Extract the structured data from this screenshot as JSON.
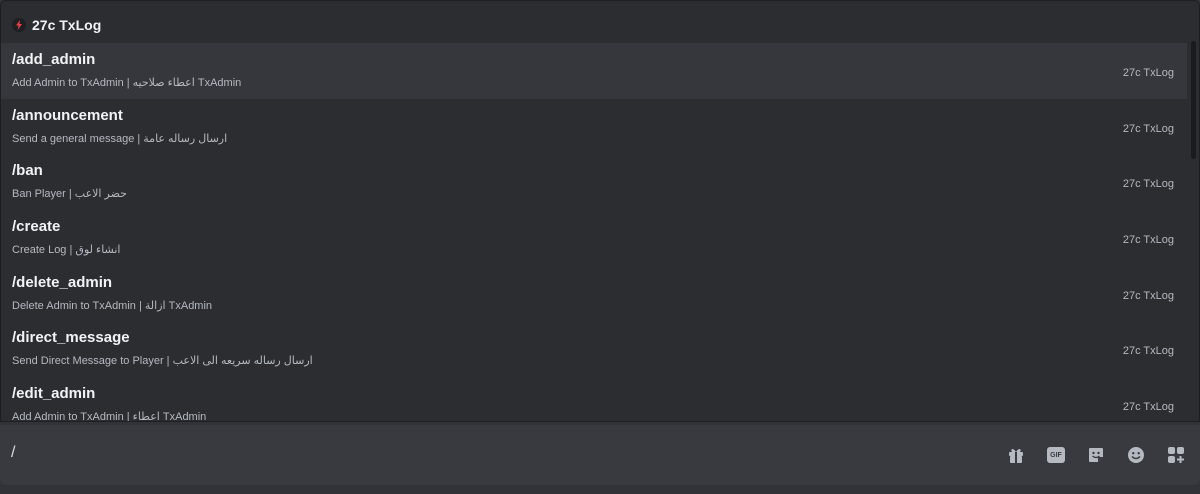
{
  "app": {
    "name": "27c TxLog"
  },
  "commands": [
    {
      "name": "/add_admin",
      "description": "Add Admin to TxAdmin | اعطاء صلاحيه TxAdmin",
      "source": "27c TxLog"
    },
    {
      "name": "/announcement",
      "description": "Send a general message | ارسال رساله عامة",
      "source": "27c TxLog"
    },
    {
      "name": "/ban",
      "description": "Ban Player | حضر الاعب",
      "source": "27c TxLog"
    },
    {
      "name": "/create",
      "description": "Create Log | انشاء لوق",
      "source": "27c TxLog"
    },
    {
      "name": "/delete_admin",
      "description": "Delete Admin to TxAdmin | ازالة TxAdmin",
      "source": "27c TxLog"
    },
    {
      "name": "/direct_message",
      "description": "Send Direct Message to Player | ارسال رساله سريعه الى الاعب",
      "source": "27c TxLog"
    },
    {
      "name": "/edit_admin",
      "description": "Add Admin to TxAdmin | اعطاء TxAdmin",
      "source": "27c TxLog"
    }
  ],
  "composer": {
    "value": "/",
    "gif_label": "GIF",
    "icons": [
      "gift-icon",
      "gif-icon",
      "sticker-icon",
      "emoji-icon",
      "apps-icon"
    ]
  },
  "colors": {
    "popup_bg": "#2b2d31",
    "selected_row": "#35373c",
    "composer_bg": "#383a40",
    "text_primary": "#f2f3f5",
    "text_muted": "#b5bac1",
    "app_icon_accent": "#ed4245"
  }
}
